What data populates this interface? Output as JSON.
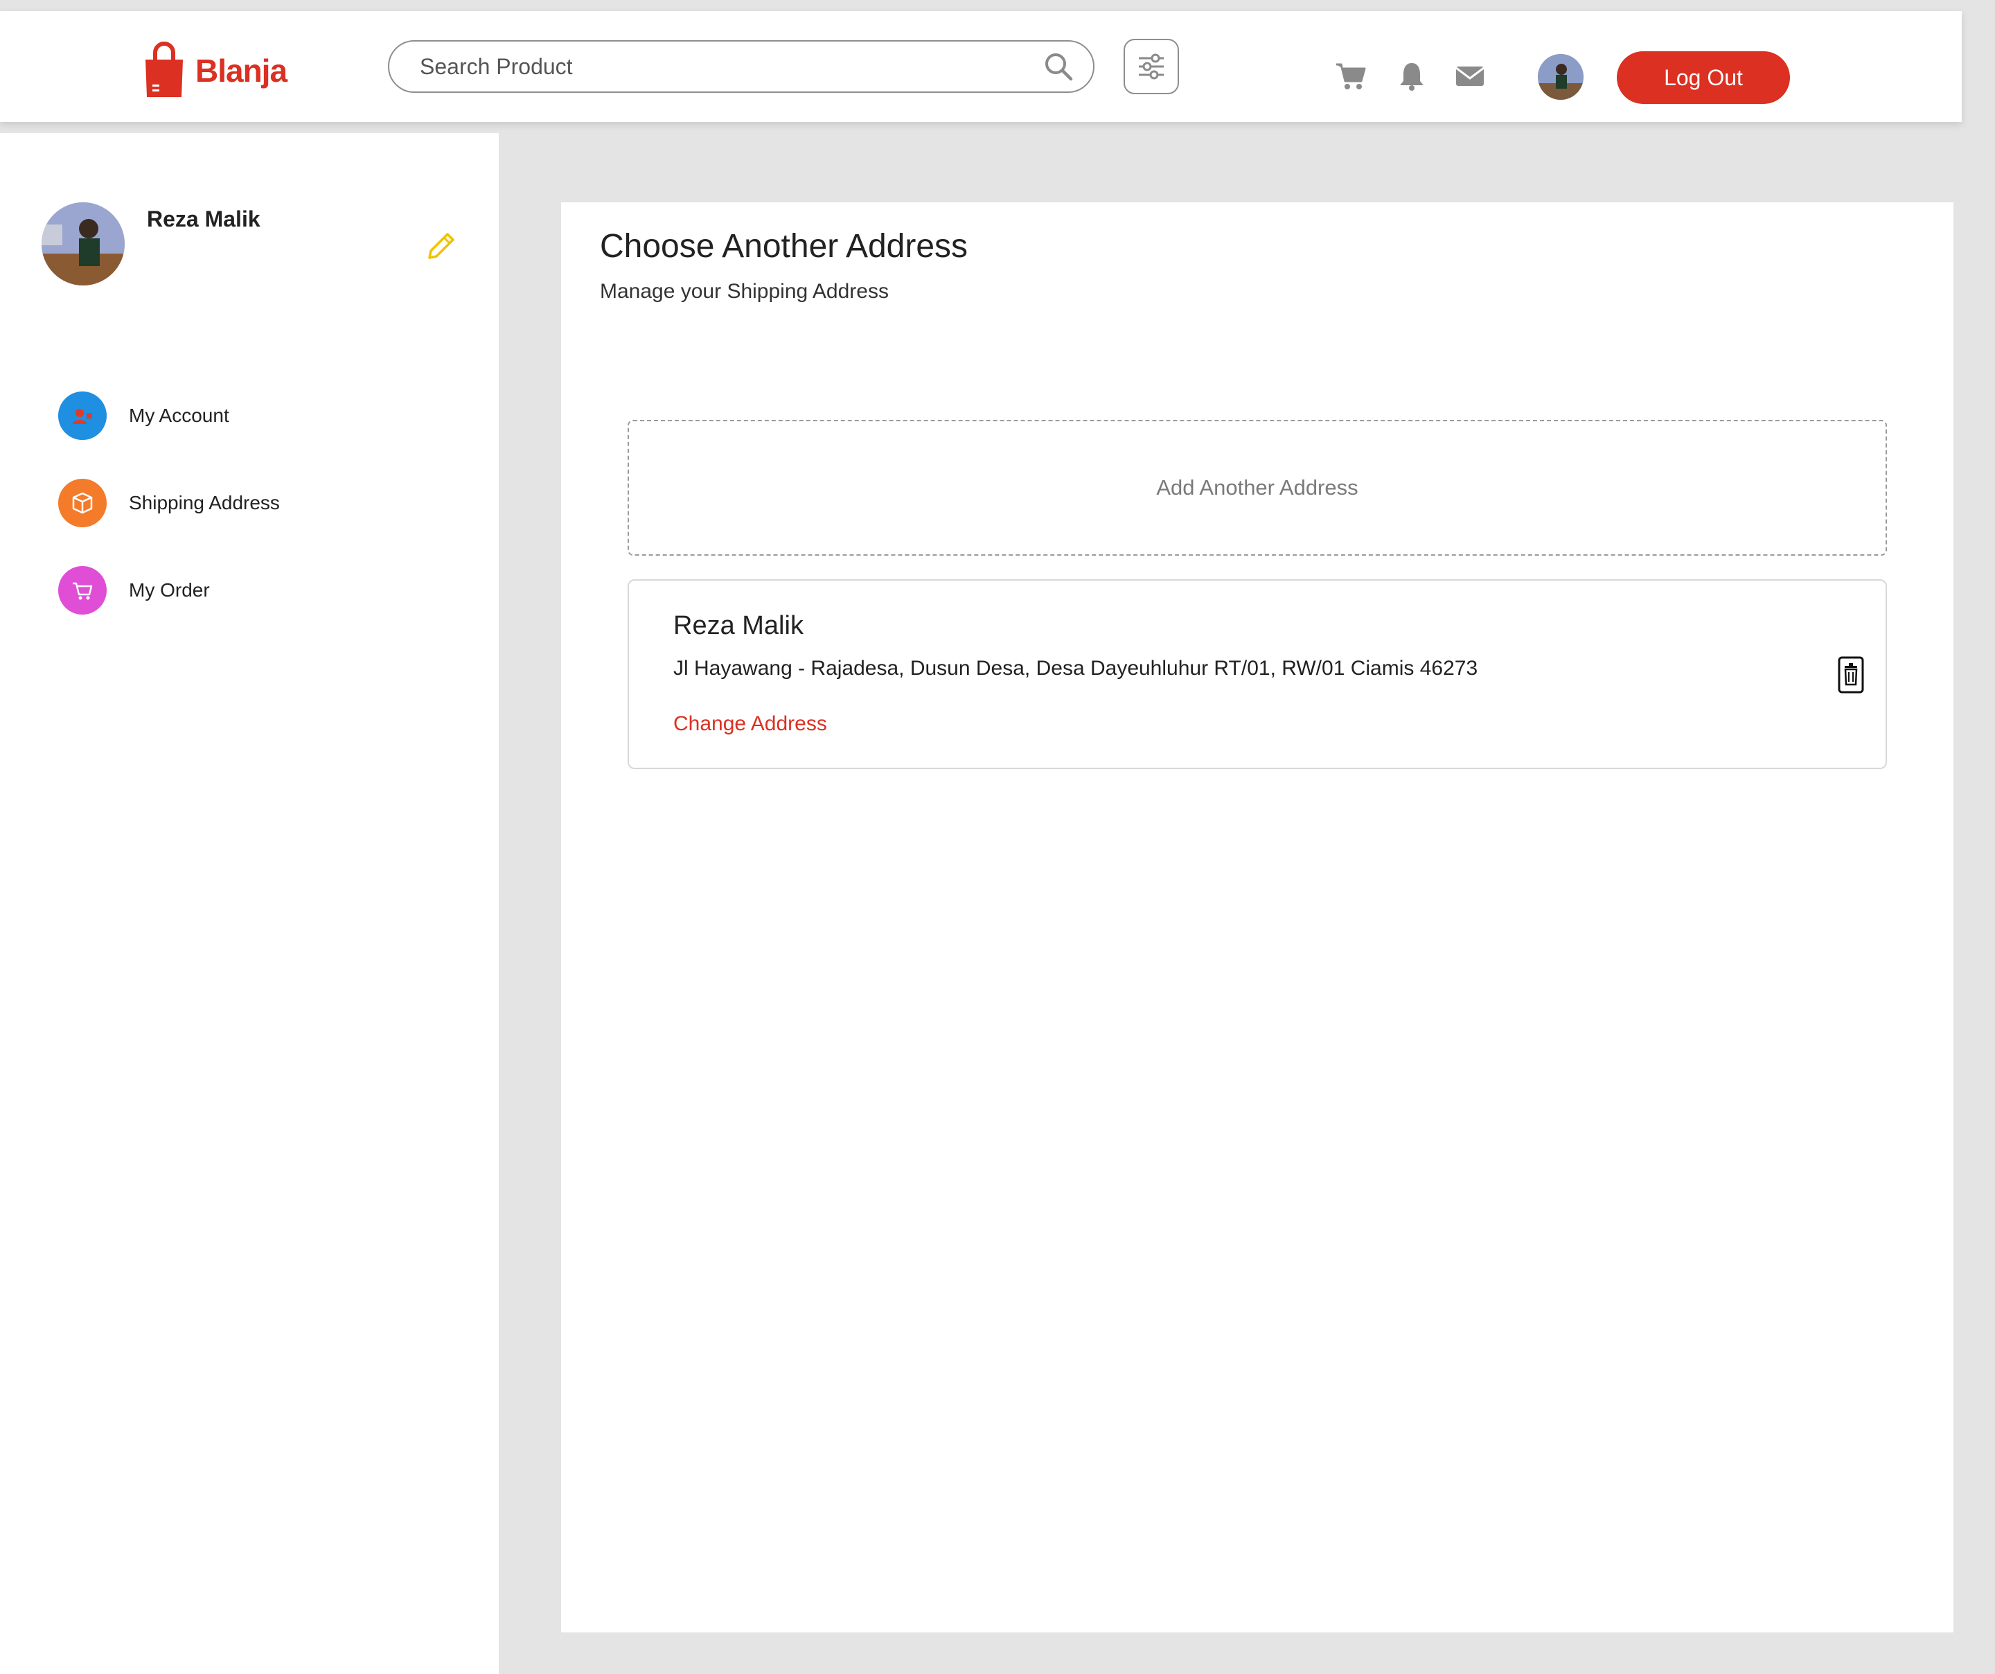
{
  "brand": {
    "name": "Blanja",
    "color": "#db3022"
  },
  "header": {
    "search_placeholder": "Search Product",
    "icons": [
      "search-icon",
      "filter-icon",
      "cart-icon",
      "bell-icon",
      "mail-icon"
    ],
    "logout_label": "Log Out"
  },
  "sidebar": {
    "user_name": "Reza Malik",
    "items": [
      {
        "label": "My Account",
        "icon": "user-icon",
        "color": "#1e8fe1"
      },
      {
        "label": "Shipping Address",
        "icon": "box-icon",
        "color": "#f47b2a"
      },
      {
        "label": "My Order",
        "icon": "cart-icon",
        "color": "#e04ed6"
      }
    ]
  },
  "main": {
    "title": "Choose Another Address",
    "subtitle": "Manage your Shipping Address",
    "add_address_label": "Add Another Address",
    "address": {
      "name": "Reza Malik",
      "text": "Jl Hayawang - Rajadesa, Dusun Desa, Desa Dayeuhluhur RT/01, RW/01 Ciamis 46273",
      "change_label": "Change Address"
    }
  }
}
